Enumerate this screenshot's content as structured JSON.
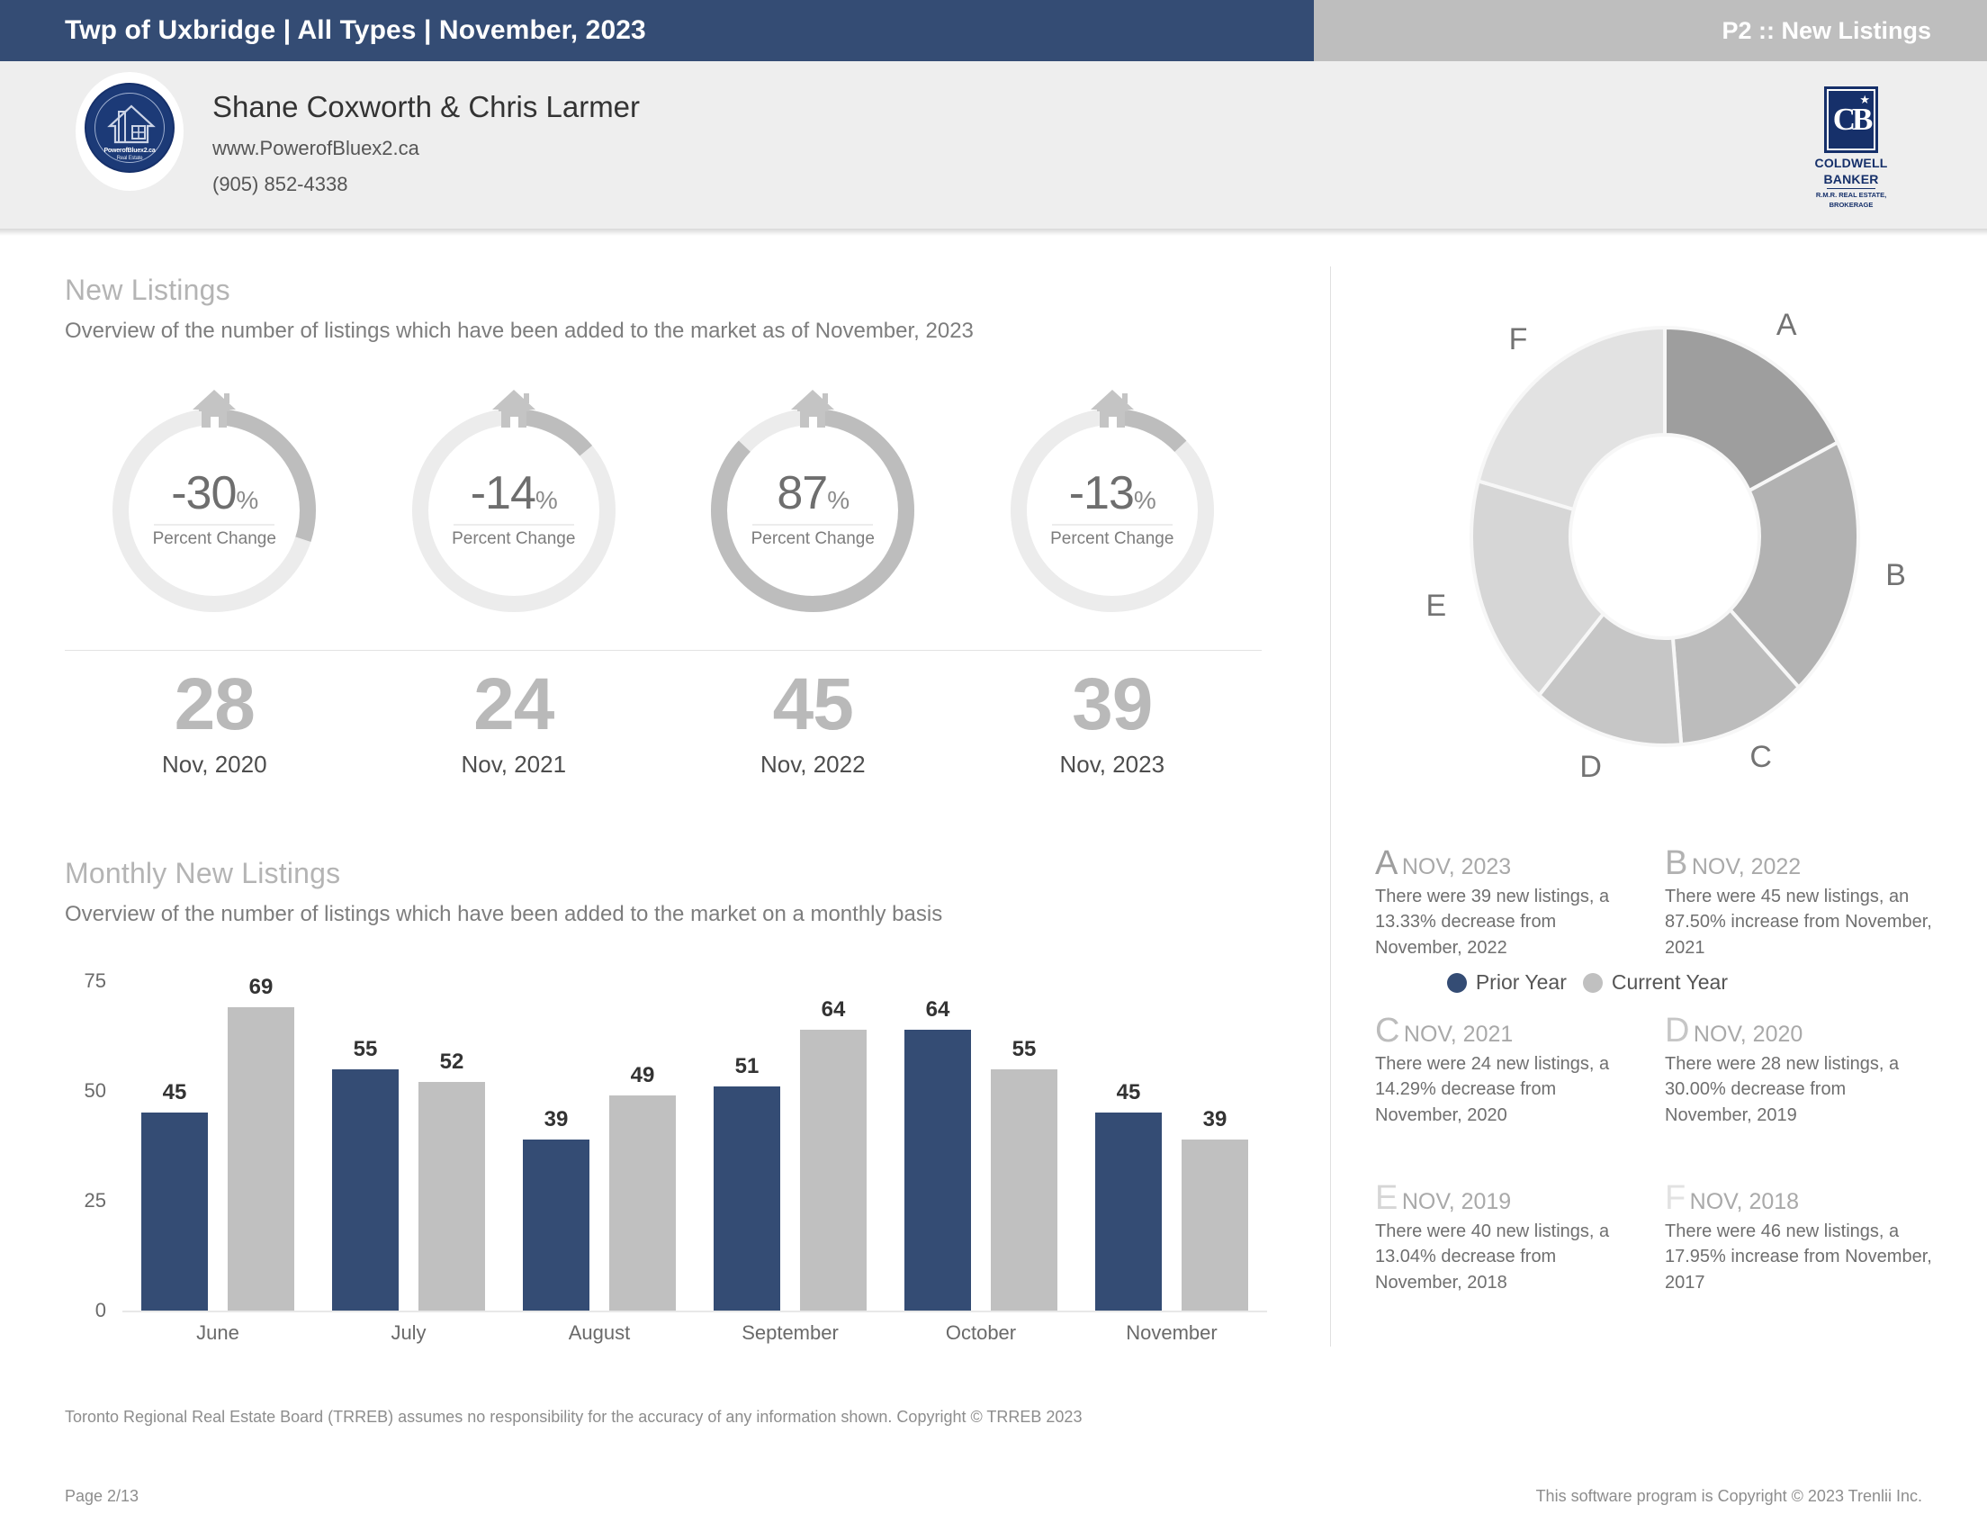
{
  "header": {
    "title": "Twp of Uxbridge | All Types | November, 2023",
    "page_label": "P2 :: New Listings",
    "navy": "#344c74",
    "gray": "#bebebe"
  },
  "agent": {
    "name": "Shane Coxworth & Chris Larmer",
    "website": "www.PowerofBluex2.ca",
    "phone": "(905) 852-4338",
    "seal_text": "PowerofBluex2.ca",
    "seal_subtext": "Real Estate",
    "brokerage": {
      "mark": "CB",
      "name_line1": "COLDWELL",
      "name_line2": "BANKER",
      "sub_line1": "R.M.R. REAL ESTATE,",
      "sub_line2": "BROKERAGE"
    }
  },
  "new_listings": {
    "title": "New Listings",
    "subtitle": "Overview of the number of listings which have been added to the market as of November, 2023",
    "gauge_label": "Percent Change",
    "gauges": [
      {
        "value": "-30",
        "unit": "%",
        "fill_percent": 30,
        "year_count": "28",
        "year_label": "Nov, 2020"
      },
      {
        "value": "-14",
        "unit": "%",
        "fill_percent": 14,
        "year_count": "24",
        "year_label": "Nov, 2021"
      },
      {
        "value": "87",
        "unit": "%",
        "fill_percent": 87,
        "year_count": "45",
        "year_label": "Nov, 2022"
      },
      {
        "value": "-13",
        "unit": "%",
        "fill_percent": 13,
        "year_count": "39",
        "year_label": "Nov, 2023"
      }
    ]
  },
  "monthly": {
    "title": "Monthly New Listings",
    "subtitle": "Overview of the number of listings which have been added to the market on a monthly basis",
    "legend": [
      {
        "label": "Prior Year",
        "color": "#344c74"
      },
      {
        "label": "Current Year",
        "color": "#c0c0c0"
      }
    ]
  },
  "chart_data": {
    "type": "bar",
    "title": "Monthly New Listings",
    "xlabel": "",
    "ylabel": "",
    "ylim": [
      0,
      75
    ],
    "yticks": [
      "0",
      "25",
      "50",
      "75"
    ],
    "grid": false,
    "legend_position": "top-right",
    "categories": [
      "June",
      "July",
      "August",
      "September",
      "October",
      "November"
    ],
    "series": [
      {
        "name": "Prior Year",
        "color": "#344c74",
        "values": [
          45,
          55,
          39,
          51,
          64,
          45
        ]
      },
      {
        "name": "Current Year",
        "color": "#c0c0c0",
        "values": [
          69,
          52,
          49,
          64,
          55,
          39
        ]
      }
    ]
  },
  "donut_chart": {
    "type": "pie",
    "title": "",
    "labels": [
      "A",
      "B",
      "C",
      "D",
      "E",
      "F"
    ],
    "values": [
      39,
      45,
      24,
      28,
      40,
      46
    ],
    "colors": [
      "#9e9e9e",
      "#b2b2b2",
      "#bcbcbc",
      "#c6c6c6",
      "#d6d6d6",
      "#e2e2e2"
    ]
  },
  "detail_blocks": [
    {
      "letter": "A",
      "letter_color": "#9e9e9e",
      "period": "NOV, 2023",
      "text": "There were 39 new listings, a 13.33% decrease from November, 2022"
    },
    {
      "letter": "B",
      "letter_color": "#b2b2b2",
      "period": "NOV, 2022",
      "text": "There were 45 new listings, an 87.50% increase from November, 2021"
    },
    {
      "letter": "C",
      "letter_color": "#bcbcbc",
      "period": "NOV, 2021",
      "text": "There were 24 new listings, a 14.29% decrease from November, 2020"
    },
    {
      "letter": "D",
      "letter_color": "#c6c6c6",
      "period": "NOV, 2020",
      "text": "There were 28 new listings, a 30.00% decrease from November, 2019"
    },
    {
      "letter": "E",
      "letter_color": "#d6d6d6",
      "period": "NOV, 2019",
      "text": "There were 40 new listings, a 13.04% decrease from November, 2018"
    },
    {
      "letter": "F",
      "letter_color": "#e2e2e2",
      "period": "NOV, 2018",
      "text": "There were 46 new listings, a 17.95% increase from November, 2017"
    }
  ],
  "footer": {
    "disclaimer": "Toronto Regional Real Estate Board (TRREB) assumes no responsibility for the accuracy of any information shown. Copyright © TRREB 2023",
    "page": "Page 2/13",
    "copyright": "This software program is Copyright © 2023 Trenlii Inc."
  }
}
